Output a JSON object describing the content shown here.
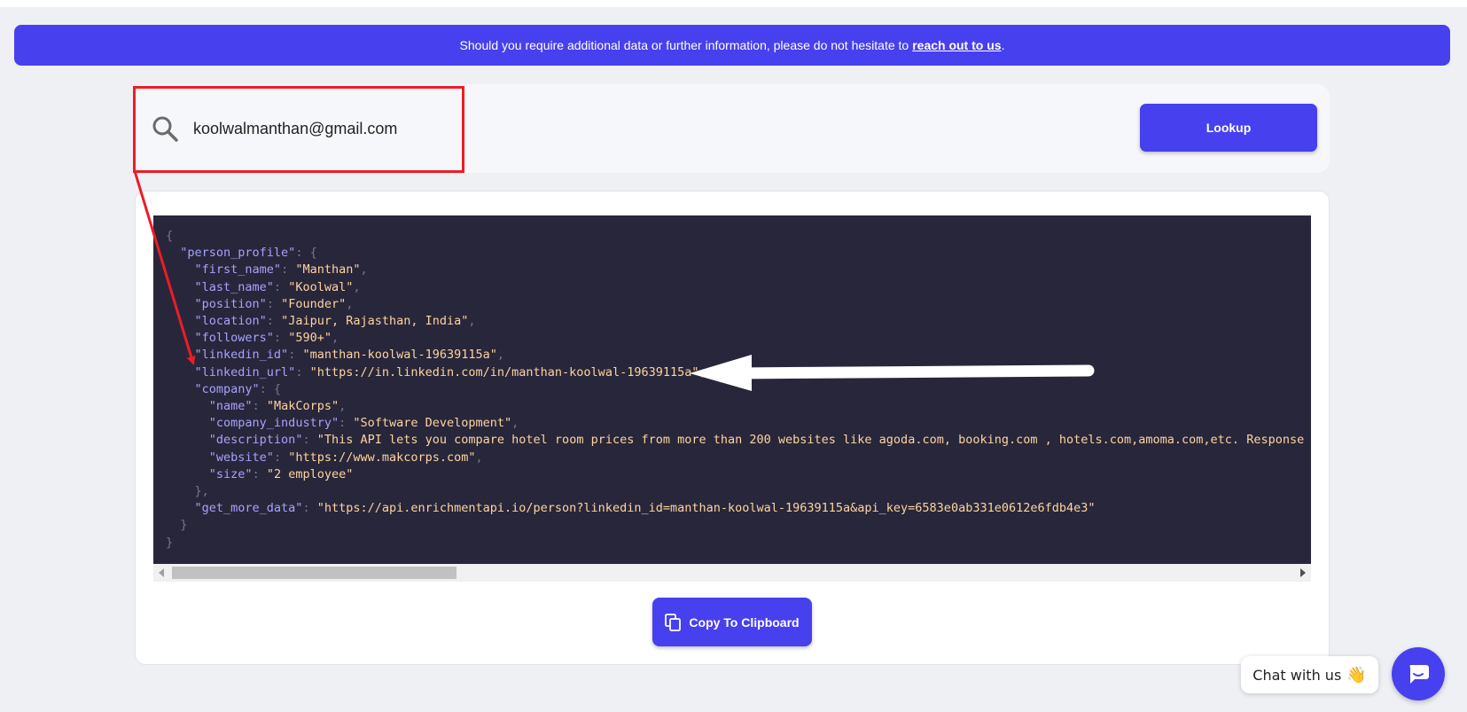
{
  "banner": {
    "message": "Should you require additional data or further information, please do not hesitate to",
    "link_text": "reach out to us",
    "suffix": "."
  },
  "search": {
    "value": "koolwalmanthan@gmail.com",
    "icon": "search-icon"
  },
  "lookup": {
    "label": "Lookup"
  },
  "json_output": {
    "lines": [
      [
        [
          "p",
          "{"
        ]
      ],
      [
        [
          "t",
          "  "
        ],
        [
          "k",
          "\"person_profile\""
        ],
        [
          "p",
          ": {"
        ]
      ],
      [
        [
          "t",
          "    "
        ],
        [
          "k",
          "\"first_name\""
        ],
        [
          "p",
          ": "
        ],
        [
          "s",
          "\"Manthan\""
        ],
        [
          "p",
          ","
        ]
      ],
      [
        [
          "t",
          "    "
        ],
        [
          "k",
          "\"last_name\""
        ],
        [
          "p",
          ": "
        ],
        [
          "s",
          "\"Koolwal\""
        ],
        [
          "p",
          ","
        ]
      ],
      [
        [
          "t",
          "    "
        ],
        [
          "k",
          "\"position\""
        ],
        [
          "p",
          ": "
        ],
        [
          "s",
          "\"Founder\""
        ],
        [
          "p",
          ","
        ]
      ],
      [
        [
          "t",
          "    "
        ],
        [
          "k",
          "\"location\""
        ],
        [
          "p",
          ": "
        ],
        [
          "s",
          "\"Jaipur, Rajasthan, India\""
        ],
        [
          "p",
          ","
        ]
      ],
      [
        [
          "t",
          "    "
        ],
        [
          "k",
          "\"followers\""
        ],
        [
          "p",
          ": "
        ],
        [
          "s",
          "\"590+\""
        ],
        [
          "p",
          ","
        ]
      ],
      [
        [
          "t",
          "    "
        ],
        [
          "k",
          "\"linkedin_id\""
        ],
        [
          "p",
          ": "
        ],
        [
          "s",
          "\"manthan-koolwal-19639115a\""
        ],
        [
          "p",
          ","
        ]
      ],
      [
        [
          "t",
          "    "
        ],
        [
          "k",
          "\"linkedin_url\""
        ],
        [
          "p",
          ": "
        ],
        [
          "s",
          "\"https://in.linkedin.com/in/manthan-koolwal-19639115a\""
        ],
        [
          "p",
          ","
        ]
      ],
      [
        [
          "t",
          "    "
        ],
        [
          "k",
          "\"company\""
        ],
        [
          "p",
          ": {"
        ]
      ],
      [
        [
          "t",
          "      "
        ],
        [
          "k",
          "\"name\""
        ],
        [
          "p",
          ": "
        ],
        [
          "s",
          "\"MakCorps\""
        ],
        [
          "p",
          ","
        ]
      ],
      [
        [
          "t",
          "      "
        ],
        [
          "k",
          "\"company_industry\""
        ],
        [
          "p",
          ": "
        ],
        [
          "s",
          "\"Software Development\""
        ],
        [
          "p",
          ","
        ]
      ],
      [
        [
          "t",
          "      "
        ],
        [
          "k",
          "\"description\""
        ],
        [
          "p",
          ": "
        ],
        [
          "s",
          "\"This API lets you compare hotel room prices from more than 200 websites like agoda.com, booking.com , hotels.com,amoma.com,etc. Response will cons"
        ]
      ],
      [
        [
          "t",
          "      "
        ],
        [
          "k",
          "\"website\""
        ],
        [
          "p",
          ": "
        ],
        [
          "s",
          "\"https://www.makcorps.com\""
        ],
        [
          "p",
          ","
        ]
      ],
      [
        [
          "t",
          "      "
        ],
        [
          "k",
          "\"size\""
        ],
        [
          "p",
          ": "
        ],
        [
          "s",
          "\"2 employee\""
        ]
      ],
      [
        [
          "t",
          "    "
        ],
        [
          "p",
          "},"
        ]
      ],
      [
        [
          "t",
          "    "
        ],
        [
          "k",
          "\"get_more_data\""
        ],
        [
          "p",
          ": "
        ],
        [
          "s",
          "\"https://api.enrichmentapi.io/person?linkedin_id=manthan-koolwal-19639115a&api_key=6583e0ab331e0612e6fdb4e3\""
        ]
      ],
      [
        [
          "t",
          "  "
        ],
        [
          "p",
          "}"
        ]
      ],
      [
        [
          "p",
          "}"
        ]
      ]
    ]
  },
  "copy": {
    "label": "Copy To Clipboard",
    "icon": "copy-icon"
  },
  "chat": {
    "label": "Chat with us",
    "emoji": "👋",
    "icon": "chat-bubble-icon"
  },
  "colors": {
    "accent": "#4740ee",
    "annotation_red": "#ee1c25",
    "code_bg": "#28263a",
    "code_key": "#a7a2ff",
    "code_string": "#ffd4a0"
  }
}
